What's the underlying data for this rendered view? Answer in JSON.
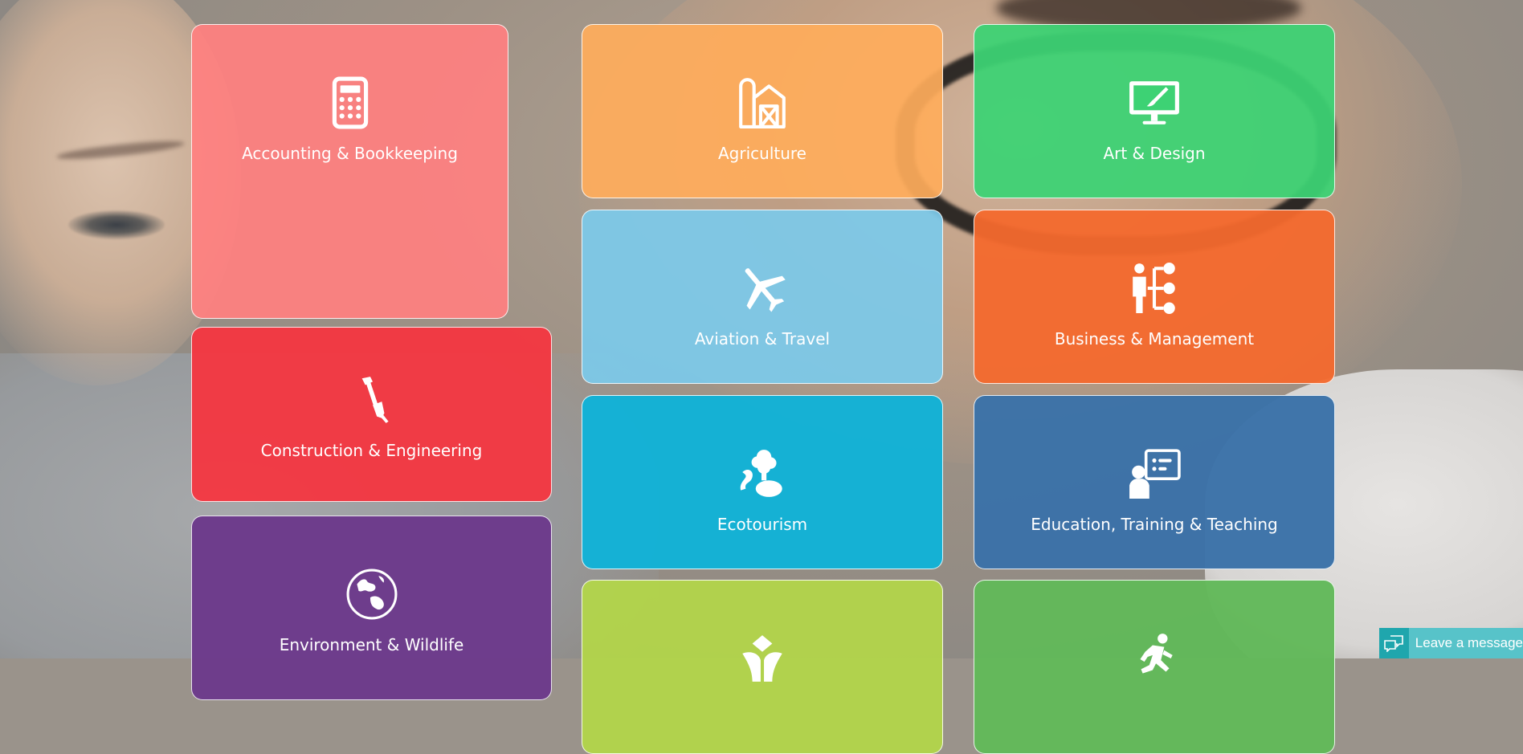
{
  "categories": [
    {
      "label": "Accounting & Bookkeeping",
      "icon": "calculator-icon",
      "color": "#ff8080"
    },
    {
      "label": "Agriculture",
      "icon": "barn-icon",
      "color": "#ffad5b"
    },
    {
      "label": "Art & Design",
      "icon": "monitor-brush-icon",
      "color": "#3dd274"
    },
    {
      "label": "Aviation & Travel",
      "icon": "airplane-icon",
      "color": "#7cc9e9"
    },
    {
      "label": "Business & Management",
      "icon": "organization-chart-icon",
      "color": "#f4692d"
    },
    {
      "label": "Construction & Engineering",
      "icon": "shovel-icon",
      "color": "#f43640"
    },
    {
      "label": "Ecotourism",
      "icon": "tree-landscape-icon",
      "color": "#10b2d7"
    },
    {
      "label": "Education, Training & Teaching",
      "icon": "teacher-board-icon",
      "color": "#3b72a8"
    },
    {
      "label": "Environment & Wildlife",
      "icon": "globe-icon",
      "color": "#6c3a8b"
    },
    {
      "label": "",
      "icon": "plant-icon",
      "color": "#b2d44b"
    },
    {
      "label": "",
      "icon": "running-person-icon",
      "color": "#62b95a"
    }
  ],
  "chat": {
    "label": "Leave a message",
    "icon": "chat-bubbles-icon",
    "color": "#57c3c9"
  }
}
